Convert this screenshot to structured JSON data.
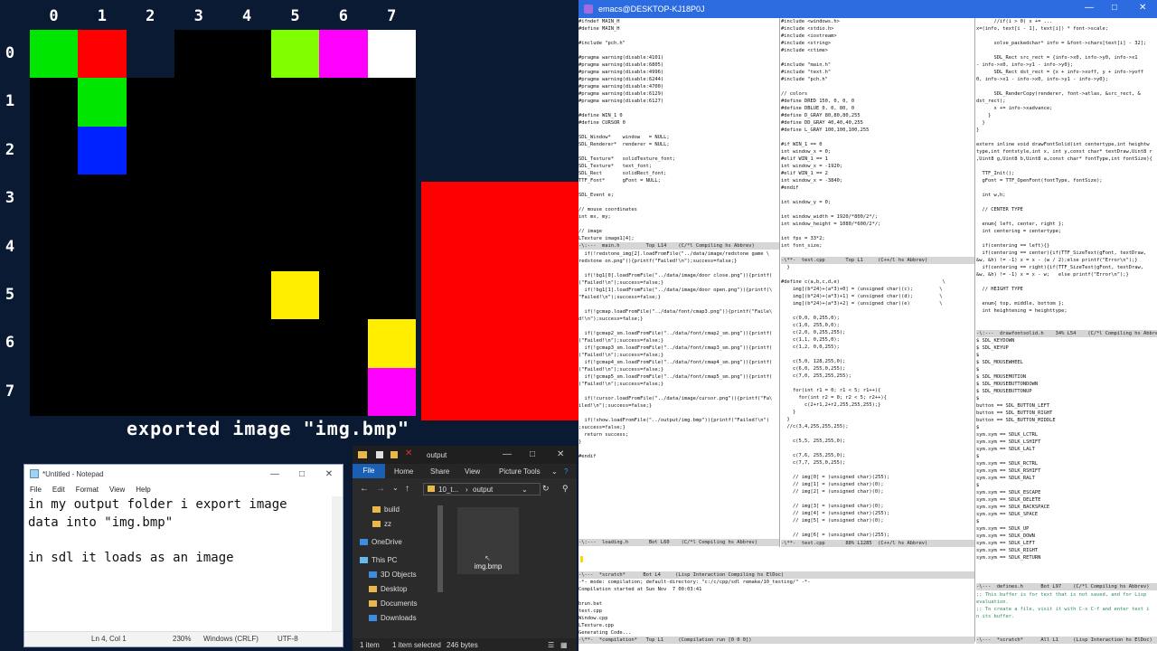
{
  "sdl_window": {
    "column_labels": [
      "0",
      "1",
      "2",
      "3",
      "4",
      "5",
      "6",
      "7"
    ],
    "row_labels": [
      "0",
      "1",
      "2",
      "3",
      "4",
      "5",
      "6",
      "7"
    ],
    "background_color": "#0b1a33",
    "grid_background": "#000000",
    "cells": [
      {
        "row": 0,
        "col": 0,
        "color": "#00e600"
      },
      {
        "row": 0,
        "col": 1,
        "color": "#ff0000"
      },
      {
        "row": 0,
        "col": 2,
        "color": "#0b1a33"
      },
      {
        "row": 0,
        "col": 5,
        "color": "#7fff00"
      },
      {
        "row": 0,
        "col": 6,
        "color": "#ff00ff"
      },
      {
        "row": 0,
        "col": 7,
        "color": "#ffffff"
      },
      {
        "row": 1,
        "col": 1,
        "color": "#00e600"
      },
      {
        "row": 2,
        "col": 1,
        "color": "#0022ff"
      },
      {
        "row": 5,
        "col": 5,
        "color": "#ffee00"
      },
      {
        "row": 6,
        "col": 7,
        "color": "#ffee00"
      },
      {
        "row": 7,
        "col": 7,
        "color": "#ff00ff"
      }
    ],
    "caption": "exported image \"img.bmp\"",
    "side_block_color": "#ff0000"
  },
  "notepad": {
    "title": "*Untitled - Notepad",
    "menu": [
      "File",
      "Edit",
      "Format",
      "View",
      "Help"
    ],
    "text": "in my output folder i export image\ndata into \"img.bmp\"\n\nin sdl it loads as an image",
    "status": {
      "position": "Ln 4, Col 1",
      "zoom": "230%",
      "line_endings": "Windows (CRLF)",
      "encoding": "UTF-8"
    }
  },
  "explorer": {
    "title": "output",
    "ribbon_tabs": [
      "File",
      "Home",
      "Share",
      "View",
      "Picture Tools"
    ],
    "breadcrumb": [
      "10_t...",
      "output"
    ],
    "nav_items": [
      {
        "label": "build",
        "icon": "folder-icon"
      },
      {
        "label": "zz",
        "icon": "folder-icon"
      },
      {
        "label": "OneDrive",
        "icon": "cloud-icon"
      },
      {
        "label": "This PC",
        "icon": "computer-icon"
      },
      {
        "label": "3D Objects",
        "icon": "cube-icon"
      },
      {
        "label": "Desktop",
        "icon": "folder-icon"
      },
      {
        "label": "Documents",
        "icon": "document-icon"
      },
      {
        "label": "Downloads",
        "icon": "download-icon"
      }
    ],
    "file": {
      "name": "img.bmp"
    },
    "status": {
      "items": "1 item",
      "selected": "1 item selected",
      "size": "246 bytes"
    }
  },
  "emacs": {
    "title": "emacs@DESKTOP-KJ18P0J",
    "pane1_code": "#ifndef MAIN_H\n#define MAIN_H\n\n#include \"pch.h\"\n\n#pragma warning(disable:4101)\n#pragma warning(disable:6805)\n#pragma warning(disable:4996)\n#pragma warning(disable:6244)\n#pragma warning(disable:4700)\n#pragma warning(disable:6129)\n#pragma warning(disable:6127)\n\n#define WIN_1 0\n#define CURSOR 0\n\nSDL_Window*    window   = NULL;\nSDL_Renderer*  renderer = NULL;\n\nSDL_Texture*   solidTexture_font;\nSDL_Texture*   text_font;\nSDL_Rect       solidRect_font;\nTTF_Font*      gFont = NULL;\n\nSDL_Event e;\n\n// mouse coordinates\nint mx, my;\n\n// image\nLTexture image1[4];",
    "pane1_mode": "-\\:---  main.h         Top L14    (C/*l Compiling hs Abbrev)",
    "pane2_code": "#include <windows.h>\n#include <stdio.h>\n#include <iostream>\n#include <string>\n#include <ctime>\n\n#include \"main.h\"\n#include \"text.h\"\n#include \"pch.h\"\n\n// colors\n#define DRED 150, 0, 0, 0\n#define DBLUE 0, 0, 80, 0\n#define D_GRAY 80,80,80,255\n#define DD_GRAY 40,40,40,255\n#define L_GRAY 100,100,100,255\n\n#if WIN_1 == 0\nint window_x = 0;\n#elif WIN_1 == 1\nint window_x = -1920;\n#elif WIN_1 == 2\nint window_x = -3840;\n#endif\n\nint window_y = 0;\n\nint window_width = 1920/*800/2*/;\nint window_height = 1080/*600/2*/;\n\nint fps = 33*2;\nint font_size;",
    "pane2_mode": "-\\**-  test.cpp       Top L1     (C++/l hs Abbrev)",
    "pane3_code": "      //if(i > 0) x += ...\nx=(info, text[i - 1], text[i]) * font->scale;\n\n      solve_packedchar* info = &font->chars[text[i] - 32];\n\n      SDL_Rect src_rect = {info->x0, info->y0, info->x1\n- info->x0, info->y1 - info->y0};\n      SDL_Rect dst_rect = {x + info->xoff, y + info->yoff\n0, info->x1 - info->x0, info->y1 - info->y0};\n\n      SDL_RenderCopy(renderer, font->atlas, &src_rect, &\ndst_rect);\n      x += info->xadvance;\n    }\n  }\n}\n\nextern inline void drawFontSolid(int centertype,int heightw\ntype,int fontstyle,int x, int y,const char* textDraw,Uint8 r\n,Uint8 g,Uint8 b,Uint8 a,const char* fontType,int fontSize){\n\n  TTF_Init();\n  gFont = TTF_OpenFont(fontType, fontSize);\n\n  int w,h;\n\n  // CENTER TYPE\n\n  enum{ left, center, right };\n  int centering = centertype;\n\n  if(centering == left){}\n  if(centering == center){if(TTF_SizeText(gFont, textDraw,\n&w, &h) != -1) x = x - (w / 2);else printf(\"Error\\n\");}\n  if(centering == right){if(TTF_SizeText(gFont, textDraw,\n&w, &h) != -1) x = x - w;   else printf(\"Error\\n\");}\n\n  // HEIGHT TYPE\n\n  enum{ top, middle, bottom };\n  int heightening = heighttype;",
    "pane3_mode": "-\\:---  drawfontsolid.h    34% L54    (C/*l Compiling hs Abbrev)",
    "pane4_code": "  if(!redstone_img[2].loadFromFile(\"../data/image/redstone game \\\nredstone on.png\")){printf(\"Failed!\\n\");success=false;}\n\n  if(!bg1[0].loadFromFile(\"../data/image/door close.png\")){printf(\n(\"Failed!\\n\");success=false;}\n  if(!bg1[1].loadFromFile(\"../data/image/door open.png\")){printf(\\\n\"Failed!\\n\");success=false;}\n\n  if(!gcmap.loadFromFile(\"../data/font/cmap3.png\")){printf(\"Faile\\\nd!\\n\");success=false;}\n\n  if(!gcmap2_sm.loadFromFile(\"../data/font/cmap2_sm.png\")){printf(\n(\"Failed!\\n\");success=false;}\n  if(!gcmap3_sm.loadFromFile(\"../data/font/cmap3_sm.png\")){printf(\n(\"Failed!\\n\");success=false;}\n  if(!gcmap4_sm.loadFromFile(\"../data/font/cmap4_sm.png\")){printf(\n(\"Failed!\\n\");success=false;}\n  if(!gcmap5_sm.loadFromFile(\"../data/font/cmap5_sm.png\")){printf(\n(\"Failed!\\n\");success=false;}\n\n  if(!cursor.loadFromFile(\"../data/image/cursor.png\")){printf(\"Fa\\\niled!\\n\");success=false;}\n\n  if(!show.loadFromFile(\"../output/img.bmp\")){printf(\"Failed!\\n\")\n;success=false;}\n  return success;\n}\n\n#endif",
    "pane4_mode": "-\\:---  loading.h       Bot L60    (C/*l Compiling hs Abbrev)",
    "pane5_code": "  }\n\n#define c(a,b,c,d,e)                                   \\\n    img[(b*24)+(a*3)+0] = (unsigned char)(c);         \\\n    img[(b*24)+(a*3)+1] = (unsigned char)(d);         \\\n    img[(b*24)+(a*3)+2] = (unsigned char)(e)          \\\n\n    c(0,0, 0,255,0);\n    c(1,0, 255,0,0);\n    c(2,0, 0,255,255);\n    c(1,1, 0,255,0);\n    c(1,2, 0,0,255);\n\n    c(5,0, 128,255,0);\n    c(6,0, 255,0,255);\n    c(7,0, 255,255,255);\n\n    for(int r1 = 0; r1 < 5; r1++){\n      for(int r2 = 0; r2 < 5; r2++){\n        c(2+r1,2+r2,255,255,255);}\n    }\n  }\n  //c(3,4,255,255,255);\n\n    c(5,5, 255,255,0);\n\n    c(7,6, 255,255,0);\n    c(7,7, 255,0,255);\n\n    // img[0] = (unsigned char)(255);\n    // img[1] = (unsigned char)(0);\n    // img[2] = (unsigned char)(0);\n\n    // img[3] = (unsigned char)(0);\n    // img[4] = (unsigned char)(255);\n    // img[5] = (unsigned char)(0);\n\n    // img[6] = (unsigned char)(255);",
    "pane5_mode": "-\\**-  test.cpp       88% L1285  (C++/l hs Abbrev)",
    "pane6_code": "$ SDL_KEYDOWN\n$ SDL_KEYUP\n$\n$ SDL_MOUSEWHEEL\n$\n$ SDL_MOUSEMOTION\n$ SDL_MOUSEBUTTONDOWN\n$ SDL_MOUSEBUTTONUP\n$\nbutton == SDL_BUTTON_LEFT\nbutton == SDL_BUTTON_RIGHT\nbutton == SDL_BUTTON_MIDDLE\n$\nsym.sym == SDLK_LCTRL\nsym.sym == SDLK_LSHIFT\nsym.sym == SDLK_LALT\n$\nsym.sym == SDLK_RCTRL\nsym.sym == SDLK_RSHIFT\nsym.sym == SDLK_RALT\n$\nsym.sym == SDLK_ESCAPE\nsym.sym == SDLK_DELETE\nsym.sym == SDLK_BACKSPACE\nsym.sym == SDLK_SPACE\n$\nsym.sym == SDLK_UP\nsym.sym == SDLK_DOWN\nsym.sym == SDLK_LEFT\nsym.sym == SDLK_RIGHT\nsym.sym == SDLK_RETURN",
    "pane6_mode": "-\\---  defines.h      Bot L97    (C/*l Compiling hs Abbrev)",
    "pane7_code": ";; This buffer is for text that is not saved, and for Lisp\nevaluation.\n;; To create a file, visit it with C-x C-f and enter text i\nn its buffer.",
    "pane7_mode": "-\\---  *scratch*      All L1     (Lisp Interaction hs ElDoc)",
    "scratch_mode": "-\\---  *scratch*      Bot L4     (Lisp Interaction Compiling hs ElDoc)",
    "compile_output": "-*- mode: compilation; default-directory: \"c:/c/cpp/sdl remake/10_testing/\" -*-\nCompilation started at Sun Nov  7 00:03:41\n\nbrun.bat\ntest.cpp\nWindow.cpp\nLTexture.cpp\nGenerating Code...",
    "compile_mode": "-\\**-  *compilation*   Top L1     (Compilation run [0 0 0])"
  }
}
